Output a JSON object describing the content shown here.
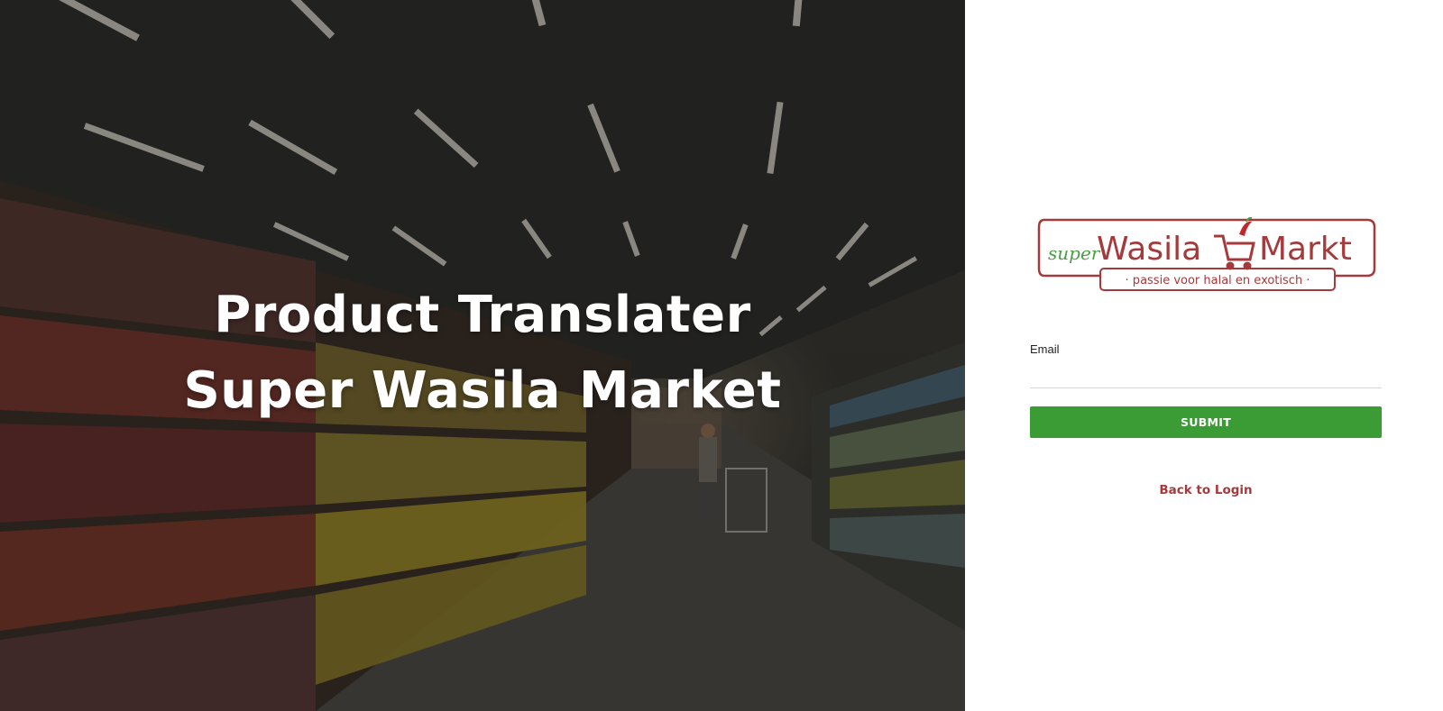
{
  "hero": {
    "title_line1": "Product Translater",
    "title_line2": "Super Wasila Market"
  },
  "logo": {
    "super": "super",
    "wasila": "Wasila",
    "markt": "Markt",
    "tagline": "· passie voor halal en exotisch ·",
    "colors": {
      "brand_red": "#a53a3c",
      "brand_green": "#4aa043"
    }
  },
  "form": {
    "email_label": "Email",
    "email_value": "",
    "email_placeholder": "",
    "submit_label": "SUBMIT",
    "back_link_label": "Back to Login"
  },
  "colors": {
    "submit_bg": "#3b9b34",
    "link": "#a53a3c"
  }
}
